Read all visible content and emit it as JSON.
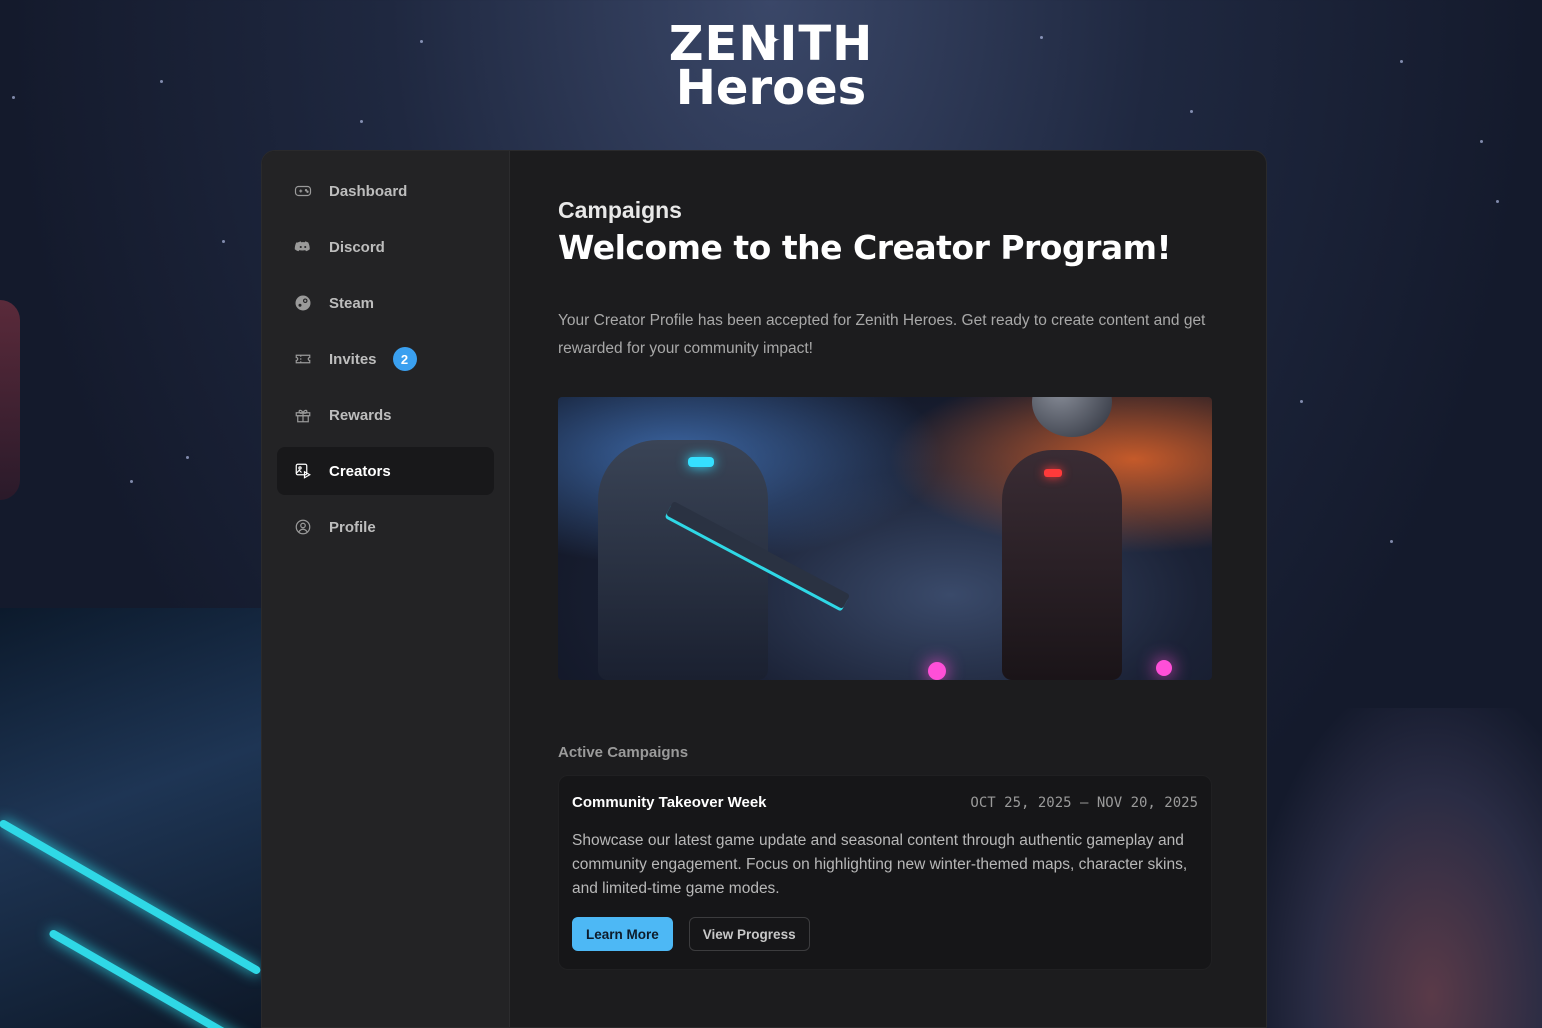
{
  "brand": {
    "line1": "ZENITH",
    "line2": "Heroes"
  },
  "sidebar": {
    "items": [
      {
        "label": "Dashboard",
        "icon": "gamepad-icon"
      },
      {
        "label": "Discord",
        "icon": "discord-icon"
      },
      {
        "label": "Steam",
        "icon": "steam-icon"
      },
      {
        "label": "Invites",
        "icon": "ticket-icon",
        "badge": "2"
      },
      {
        "label": "Rewards",
        "icon": "gift-icon"
      },
      {
        "label": "Creators",
        "icon": "creator-media-icon",
        "active": true
      },
      {
        "label": "Profile",
        "icon": "user-circle-icon"
      }
    ]
  },
  "main": {
    "section": "Campaigns",
    "title": "Welcome to the Creator Program!",
    "intro": "Your Creator Profile has been accepted for Zenith Heroes. Get ready to create content and get rewarded for your community impact!",
    "active_heading": "Active Campaigns",
    "campaign": {
      "title": "Community Takeover Week",
      "dates": "OCT 25, 2025 – NOV 20, 2025",
      "description": "Showcase our latest game update and seasonal content through authentic gameplay and community engagement. Focus on highlighting new winter-themed maps, character skins, and limited-time game modes.",
      "primary_label": "Learn More",
      "secondary_label": "View Progress"
    }
  },
  "colors": {
    "accent": "#4db8f5",
    "badge": "#3aa0f0",
    "panel": "#1c1c1e",
    "sidebar": "#232325"
  }
}
